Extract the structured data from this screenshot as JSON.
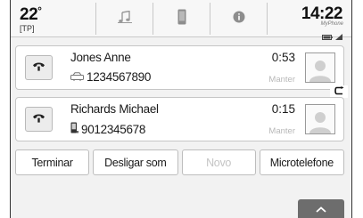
{
  "status": {
    "temperature": "22",
    "temperature_unit": "°",
    "traffic_program": "[TP]",
    "clock": "14:22",
    "carrier": "MyPhone",
    "tabs": [
      {
        "icon": "music-note-icon"
      },
      {
        "icon": "phone-device-icon"
      },
      {
        "icon": "info-icon"
      }
    ]
  },
  "calls": [
    {
      "name": "Jones Anne",
      "number": "1234567890",
      "number_type_icon": "car-phone-icon",
      "duration": "0:53",
      "hold_label": "Manter",
      "call_icon": "phone-handset-icon",
      "avatar_icon": "contact-avatar-icon"
    },
    {
      "name": "Richards Michael",
      "number": "9012345678",
      "number_type_icon": "mobile-phone-icon",
      "duration": "0:15",
      "hold_label": "Manter",
      "call_icon": "phone-handset-icon",
      "avatar_icon": "contact-avatar-icon"
    }
  ],
  "swap_icon": "swap-calls-icon",
  "actions": {
    "end": "Terminar",
    "mute": "Desligar som",
    "new": "Novo",
    "handset": "Microtelefone"
  },
  "expand_icon": "chevron-up-icon",
  "colors": {
    "background": "#f2f2f2",
    "card": "#ffffff",
    "disabled_text": "#c4c4c4",
    "expand_button": "#6d6d6d"
  }
}
